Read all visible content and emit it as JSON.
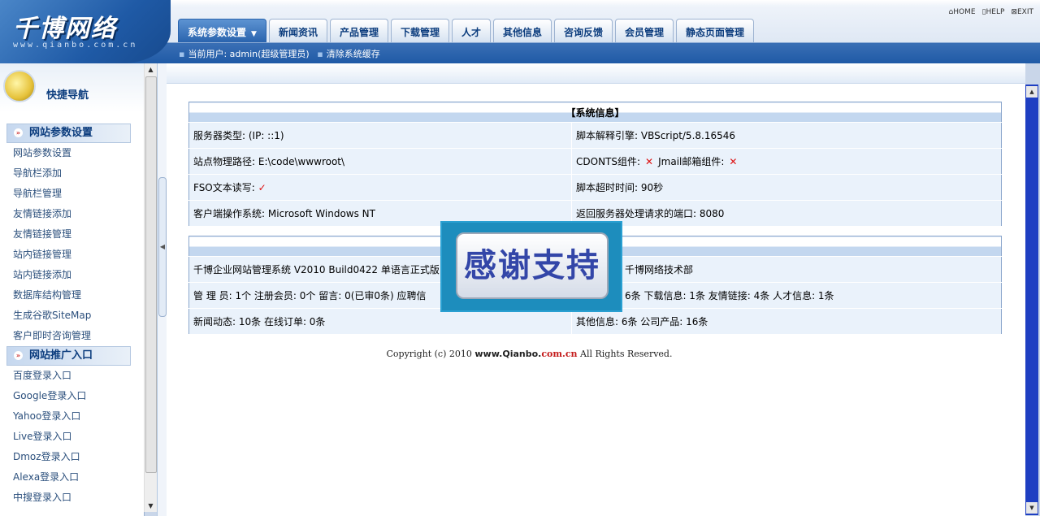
{
  "header": {
    "logo_text": "千博网络",
    "logo_sub": "www.qianbo.com.cn",
    "tabs": [
      {
        "label": "系统参数设置"
      },
      {
        "label": "新闻资讯"
      },
      {
        "label": "产品管理"
      },
      {
        "label": "下载管理"
      },
      {
        "label": "人才"
      },
      {
        "label": "其他信息"
      },
      {
        "label": "咨询反馈"
      },
      {
        "label": "会员管理"
      },
      {
        "label": "静态页面管理"
      }
    ],
    "toplinks": {
      "home": "HOME",
      "help": "HELP",
      "exit": "EXIT"
    },
    "user_label": "当前用户: admin(超级管理员)",
    "clear_cache": "清除系统缓存"
  },
  "sidebar": {
    "title": "快捷导航",
    "section1": "网站参数设置",
    "items1": [
      "网站参数设置",
      "导航栏添加",
      "导航栏管理",
      "友情链接添加",
      "友情链接管理",
      "站内链接管理",
      "站内链接添加",
      "数据库结构管理",
      "生成谷歌SiteMap",
      "客户即时咨询管理"
    ],
    "section2": "网站推广入口",
    "items2": [
      "百度登录入口",
      "Google登录入口",
      "Yahoo登录入口",
      "Live登录入口",
      "Dmoz登录入口",
      "Alexa登录入口",
      "中搜登录入口"
    ]
  },
  "sysinfo": {
    "title": "【系统信息】",
    "server_type": "服务器类型: (IP: ::1)",
    "script_engine": "脚本解释引擎: VBScript/5.8.16546",
    "site_path": "站点物理路径: E:\\code\\wwwroot\\",
    "cdonts": "CDONTS组件:",
    "jmail": "Jmail邮箱组件:",
    "fso": "FSO文本读写:",
    "script_timeout": "脚本超时时间: 90秒",
    "client_os": "客户端操作系统: Microsoft Windows NT",
    "server_port": "返回服务器处理请求的端口: 8080"
  },
  "siteinfo": {
    "title": "】",
    "version": "千博企业网站管理系统 V2010 Build0422 单语言正式版",
    "developer": "千博网络技术部",
    "stats1_left": "管 理 员: 1个 注册会员: 0个 留言: 0(已审0条) 应聘信",
    "stats1_right": "6条 下载信息: 1条 友情链接: 4条 人才信息: 1条",
    "stats2_left": "新闻动态: 10条 在线订单: 0条",
    "stats2_right": "其他信息: 6条 公司产品: 16条"
  },
  "footer": {
    "prefix": "Copyright (c) 2010",
    "domain_a": "www.Qianbo.",
    "domain_b": "com.cn",
    "suffix": "All Rights Reserved."
  },
  "overlay": {
    "text": "感谢支持"
  },
  "colors": {
    "brand_blue": "#1f5aa6",
    "badge": "#1d8dbd",
    "status_red": "#d11111"
  },
  "icons": {
    "cross": "✕",
    "check": "✓"
  }
}
